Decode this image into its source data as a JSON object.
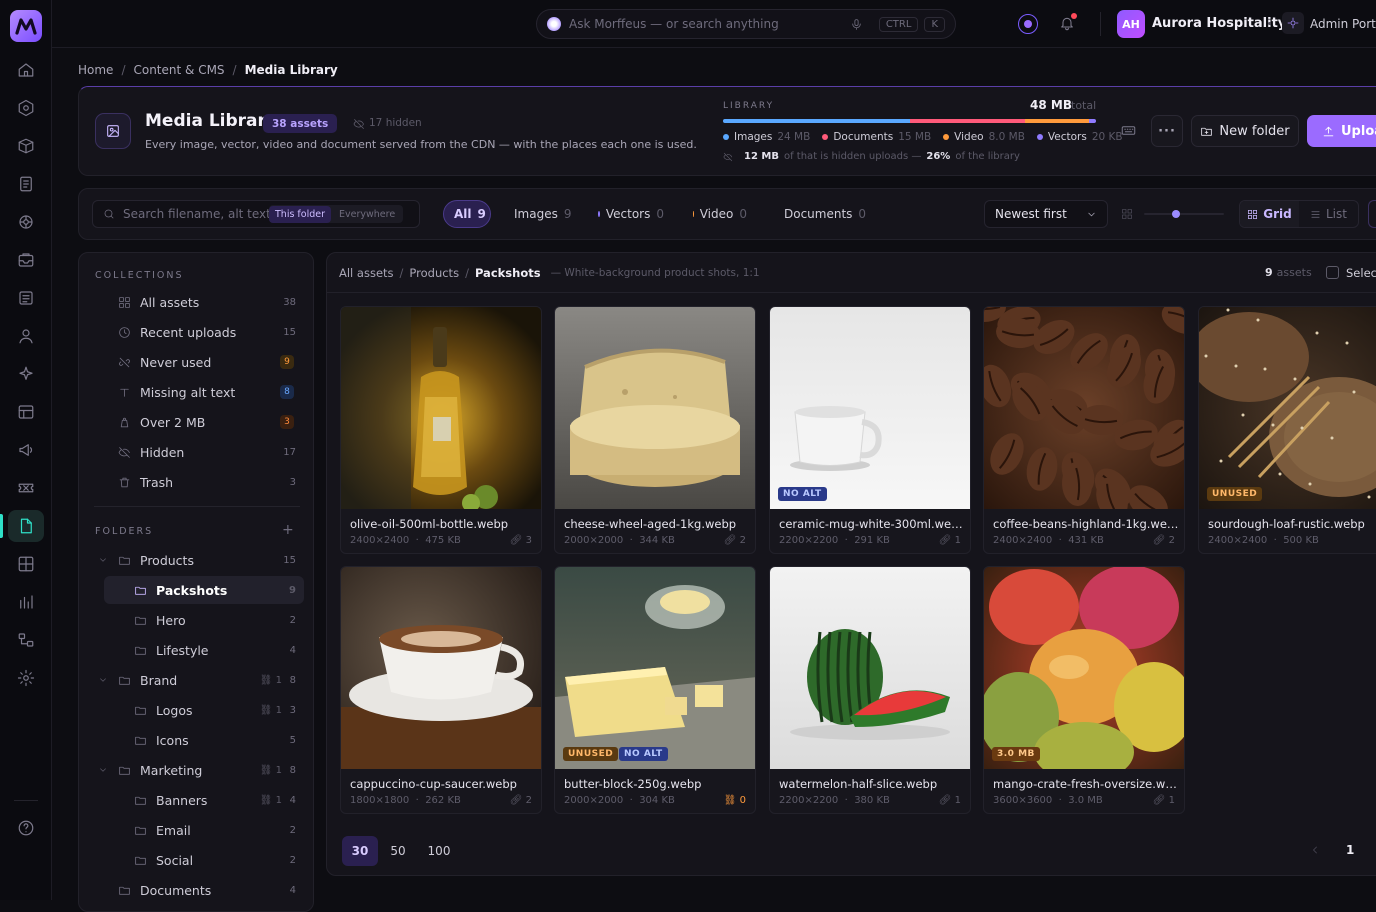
{
  "colors": {
    "accent": "#9b6bff",
    "teal": "#2fe0c8",
    "images": "#5aa8ff",
    "documents": "#ff5a7a",
    "video": "#ff9a3c",
    "vectors": "#8f7bff"
  },
  "topbar": {
    "search_placeholder": "Ask Morffeus — or search anything",
    "kbd1": "CTRL",
    "kbd2": "K",
    "org_initials": "AH",
    "org_name": "Aurora Hospitality",
    "portal": "Admin Porta"
  },
  "breadcrumb": [
    "Home",
    "Content & CMS",
    "Media Library"
  ],
  "header": {
    "title": "Media Library",
    "assets_badge": "38 assets",
    "hidden": "17 hidden",
    "description": "Every image, vector, video and document served from the CDN — with the places each one is used.",
    "library_label": "LIBRARY",
    "total_value": "48 MB",
    "total_suffix": "total",
    "legend": [
      {
        "name": "Images",
        "size": "24 MB",
        "color": "#5aa8ff",
        "fraction": 0.5
      },
      {
        "name": "Documents",
        "size": "15 MB",
        "color": "#ff5a7a",
        "fraction": 0.31
      },
      {
        "name": "Video",
        "size": "8.0 MB",
        "color": "#ff9a3c",
        "fraction": 0.17
      },
      {
        "name": "Vectors",
        "size": "20 KB",
        "color": "#8f7bff",
        "fraction": 0.02
      }
    ],
    "hidden_uploads_size": "12 MB",
    "hidden_uploads_text": "of that is hidden uploads —",
    "hidden_pct": "26%",
    "hidden_pct_suffix": "of the library",
    "new_folder": "New folder",
    "upload": "Uploa"
  },
  "filters": {
    "search_placeholder": "Search filename, alt text o",
    "scope_this": "This folder",
    "scope_everywhere": "Everywhere",
    "chips": [
      {
        "label": "All",
        "count": "9",
        "color": ""
      },
      {
        "label": "Images",
        "count": "9",
        "color": "#5aa8ff"
      },
      {
        "label": "Vectors",
        "count": "0",
        "color": "#8f7bff"
      },
      {
        "label": "Video",
        "count": "0",
        "color": "#ff9a3c"
      },
      {
        "label": "Documents",
        "count": "0",
        "color": "#ff5a7a"
      }
    ],
    "sort": "Newest first",
    "view_grid": "Grid",
    "view_list": "List"
  },
  "sidebar": {
    "collections_title": "COLLECTIONS",
    "collections": [
      {
        "label": "All assets",
        "count": "38",
        "icon": "grid-icon"
      },
      {
        "label": "Recent uploads",
        "count": "15",
        "icon": "clock-icon"
      },
      {
        "label": "Never used",
        "count": "9",
        "icon": "unlink-icon"
      },
      {
        "label": "Missing alt text",
        "count": "8",
        "icon": "type-icon"
      },
      {
        "label": "Over 2 MB",
        "count": "3",
        "icon": "weight-icon"
      },
      {
        "label": "Hidden",
        "count": "17",
        "icon": "eye-off-icon"
      },
      {
        "label": "Trash",
        "count": "3",
        "icon": "trash-icon"
      }
    ],
    "folders_title": "FOLDERS",
    "folders": [
      {
        "label": "Products",
        "count": "15",
        "links": ""
      },
      {
        "label": "Packshots",
        "count": "9",
        "links": ""
      },
      {
        "label": "Hero",
        "count": "2",
        "links": ""
      },
      {
        "label": "Lifestyle",
        "count": "4",
        "links": ""
      },
      {
        "label": "Brand",
        "count": "8",
        "links": "1"
      },
      {
        "label": "Logos",
        "count": "3",
        "links": "1"
      },
      {
        "label": "Icons",
        "count": "5",
        "links": ""
      },
      {
        "label": "Marketing",
        "count": "8",
        "links": "1"
      },
      {
        "label": "Banners",
        "count": "4",
        "links": "1"
      },
      {
        "label": "Email",
        "count": "2",
        "links": ""
      },
      {
        "label": "Social",
        "count": "2",
        "links": ""
      },
      {
        "label": "Documents",
        "count": "4",
        "links": ""
      }
    ]
  },
  "content": {
    "crumb": [
      "All assets",
      "Products",
      "Packshots"
    ],
    "folder_desc": "— White-background product shots, 1:1",
    "count_num": "9",
    "count_label": "assets",
    "select": "Selec",
    "tiles": [
      {
        "name": "olive-oil-500ml-bottle.webp",
        "dims": "2400×2400",
        "size": "475 KB",
        "uses": "3",
        "tags": []
      },
      {
        "name": "cheese-wheel-aged-1kg.webp",
        "dims": "2000×2000",
        "size": "344 KB",
        "uses": "2",
        "tags": []
      },
      {
        "name": "ceramic-mug-white-300ml.we…",
        "dims": "2200×2200",
        "size": "291 KB",
        "uses": "1",
        "tags": [
          "NO ALT"
        ]
      },
      {
        "name": "coffee-beans-highland-1kg.webp",
        "dims": "2400×2400",
        "size": "431 KB",
        "uses": "2",
        "tags": []
      },
      {
        "name": "sourdough-loaf-rustic.webp",
        "dims": "2400×2400",
        "size": "500 KB",
        "uses": "",
        "tags": [
          "UNUSED"
        ]
      },
      {
        "name": "cappuccino-cup-saucer.webp",
        "dims": "1800×1800",
        "size": "262 KB",
        "uses": "2",
        "tags": []
      },
      {
        "name": "butter-block-250g.webp",
        "dims": "2000×2000",
        "size": "304 KB",
        "uses": "0",
        "tags": [
          "UNUSED",
          "NO ALT"
        ]
      },
      {
        "name": "watermelon-half-slice.webp",
        "dims": "2200×2200",
        "size": "380 KB",
        "uses": "1",
        "tags": []
      },
      {
        "name": "mango-crate-fresh-oversize.we…",
        "dims": "3600×3600",
        "size": "3.0 MB",
        "uses": "1",
        "tags": [
          "3.0 MB"
        ]
      }
    ],
    "page_sizes": [
      "30",
      "50",
      "100"
    ],
    "page": "1"
  }
}
